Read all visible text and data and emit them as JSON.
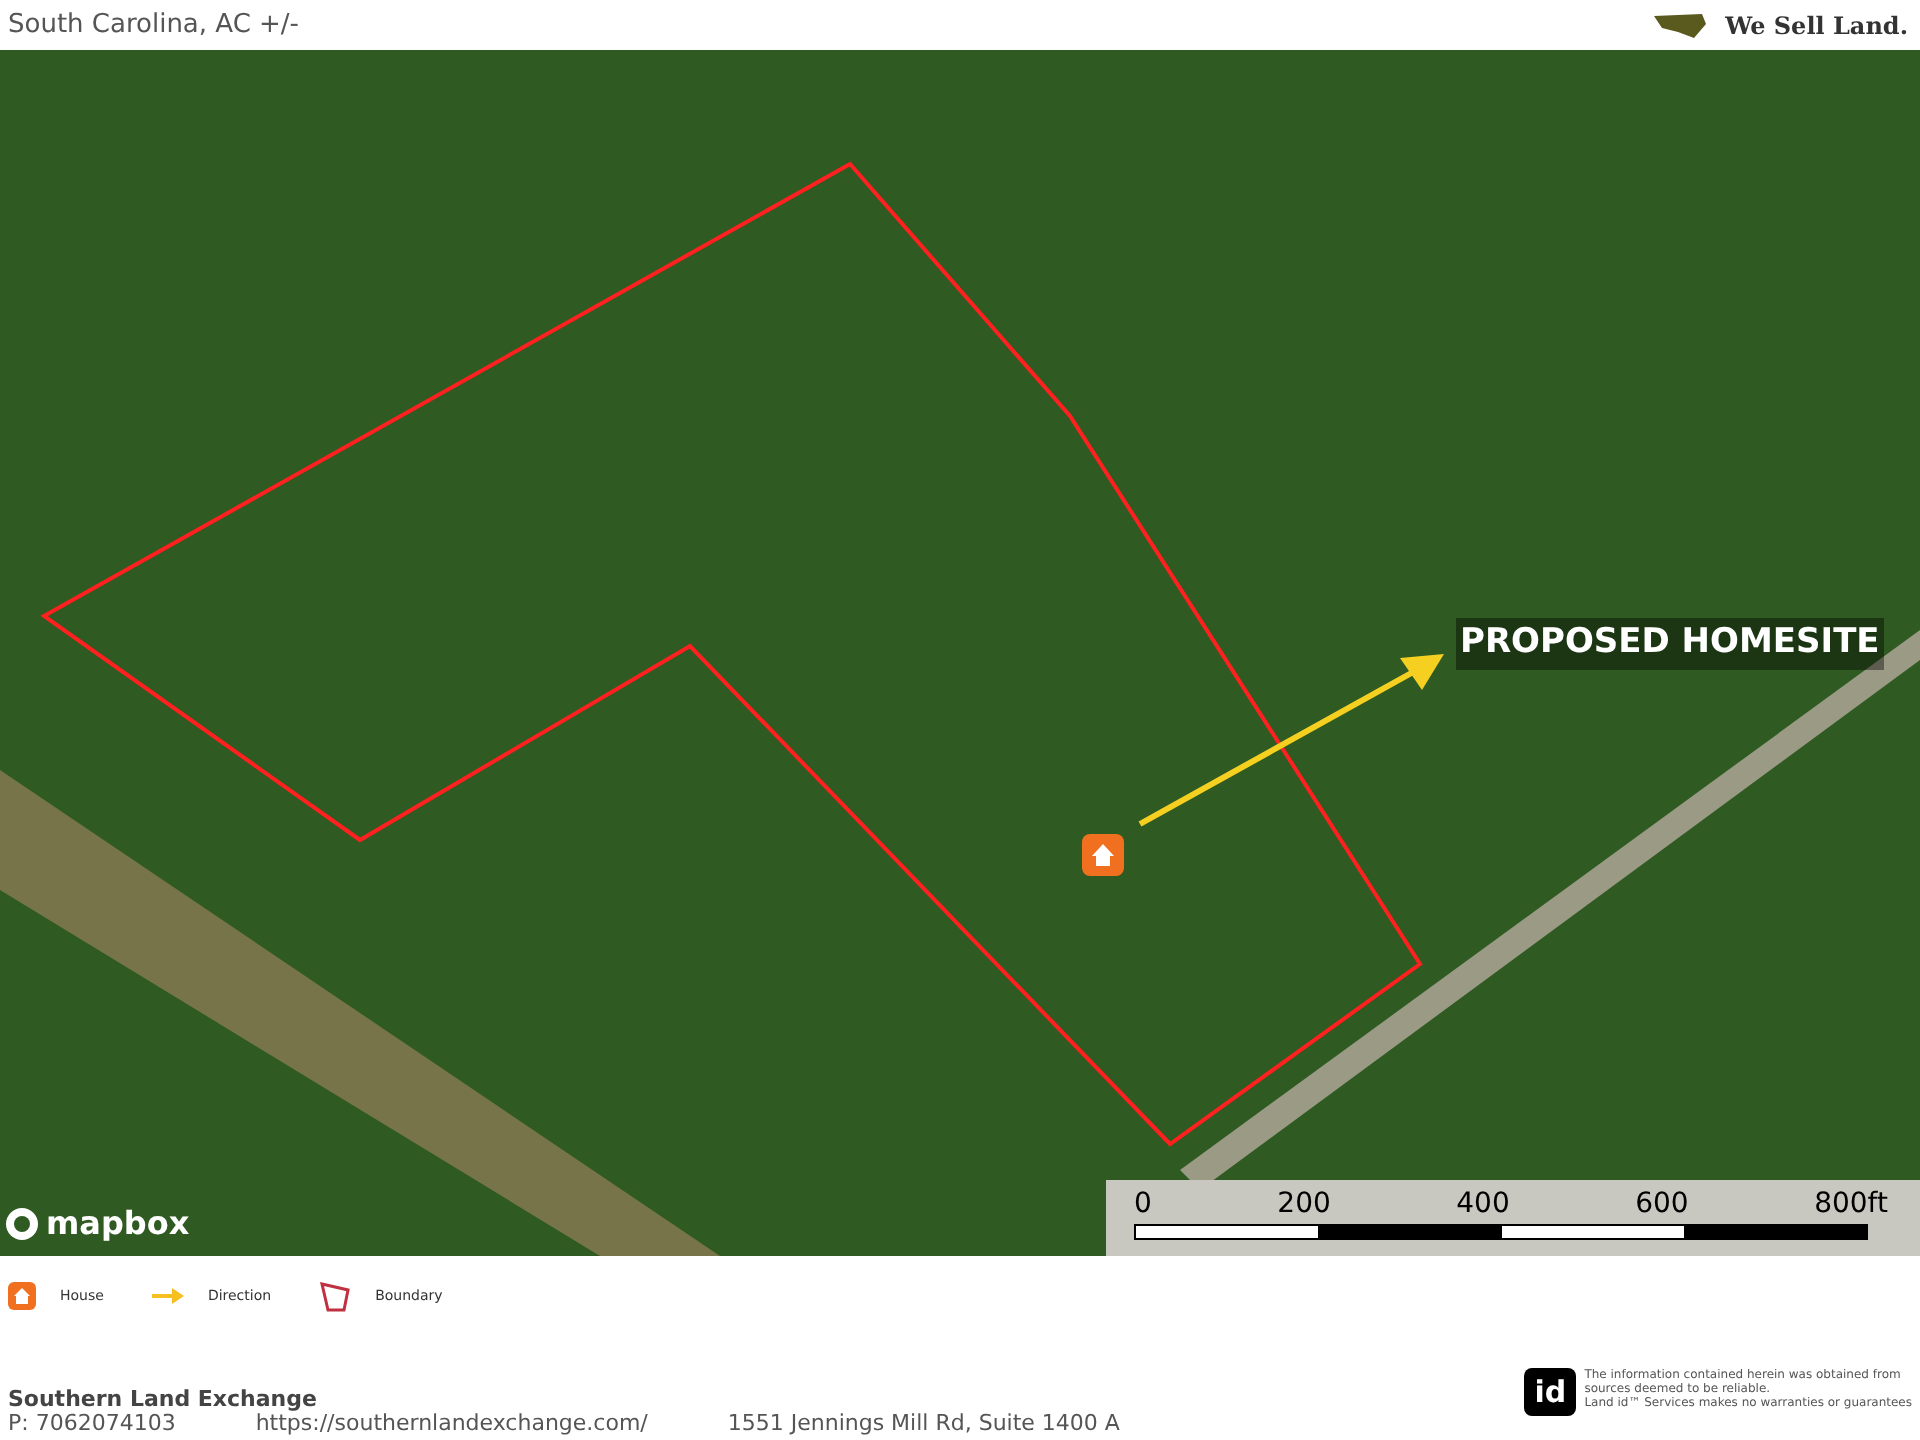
{
  "header": {
    "subtitle": "South Carolina,  AC +/-",
    "logo_text": "We Sell Land."
  },
  "map": {
    "label": "PROPOSED HOMESITE",
    "attribution": "mapbox",
    "scale_ticks": [
      "0",
      "200",
      "400",
      "600",
      "800ft"
    ]
  },
  "legend": [
    {
      "kind": "house",
      "label": "House"
    },
    {
      "kind": "direction",
      "label": "Direction"
    },
    {
      "kind": "boundary",
      "label": "Boundary"
    }
  ],
  "footer": {
    "company": "Southern Land Exchange",
    "phone": "P: 7062074103",
    "url": "https://southernlandexchange.com/",
    "address": "1551 Jennings Mill Rd, Suite 1400 A",
    "badge": "id",
    "disclaimer": [
      "The information contained herein was obtained from",
      "sources deemed to be reliable.",
      "Land id™ Services makes no warranties or guarantees"
    ]
  }
}
